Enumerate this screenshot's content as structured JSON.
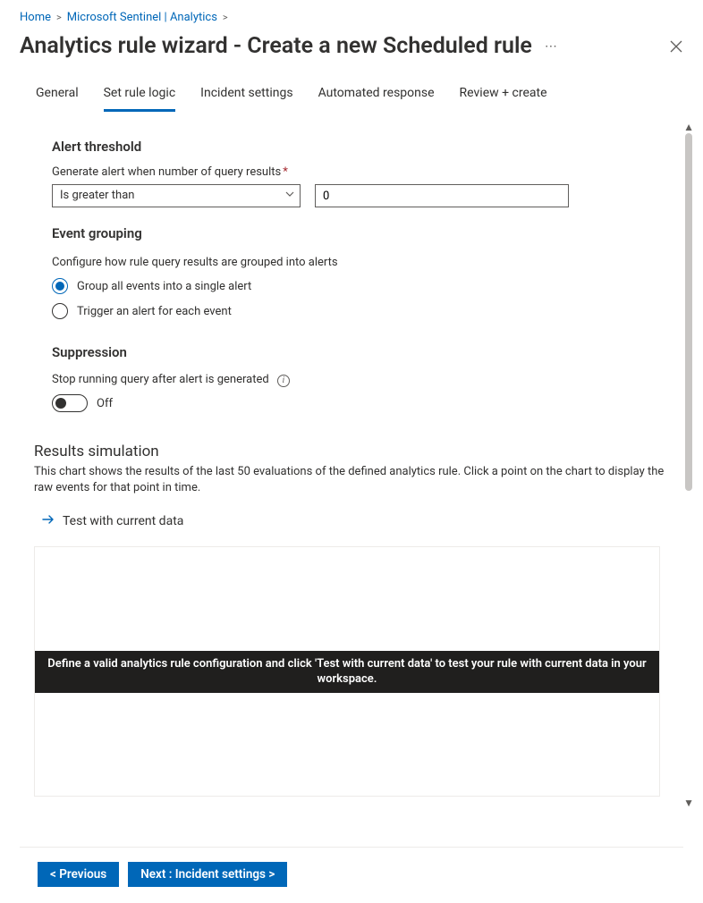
{
  "breadcrumb": {
    "items": [
      "Home",
      "Microsoft Sentinel | Analytics"
    ]
  },
  "page_title": "Analytics rule wizard - Create a new Scheduled rule",
  "tabs": {
    "general": "General",
    "set_rule_logic": "Set rule logic",
    "incident_settings": "Incident settings",
    "automated_response": "Automated response",
    "review_create": "Review + create",
    "active": "set_rule_logic"
  },
  "alert_threshold": {
    "heading": "Alert threshold",
    "label": "Generate alert when number of query results",
    "operator": "Is greater than",
    "value": "0"
  },
  "event_grouping": {
    "heading": "Event grouping",
    "description": "Configure how rule query results are grouped into alerts",
    "options": {
      "group_all": "Group all events into a single alert",
      "each": "Trigger an alert for each event"
    },
    "selected": "group_all"
  },
  "suppression": {
    "heading": "Suppression",
    "label": "Stop running query after alert is generated",
    "value_label": "Off",
    "value": false
  },
  "results_simulation": {
    "heading": "Results simulation",
    "description": "This chart shows the results of the last 50 evaluations of the defined analytics rule. Click a point on the chart to display the raw events for that point in time.",
    "test_link": "Test with current data",
    "banner": "Define a valid analytics rule configuration and click 'Test with current data' to test your rule with current data in your workspace."
  },
  "footer": {
    "previous": "< Previous",
    "next": "Next : Incident settings >"
  }
}
